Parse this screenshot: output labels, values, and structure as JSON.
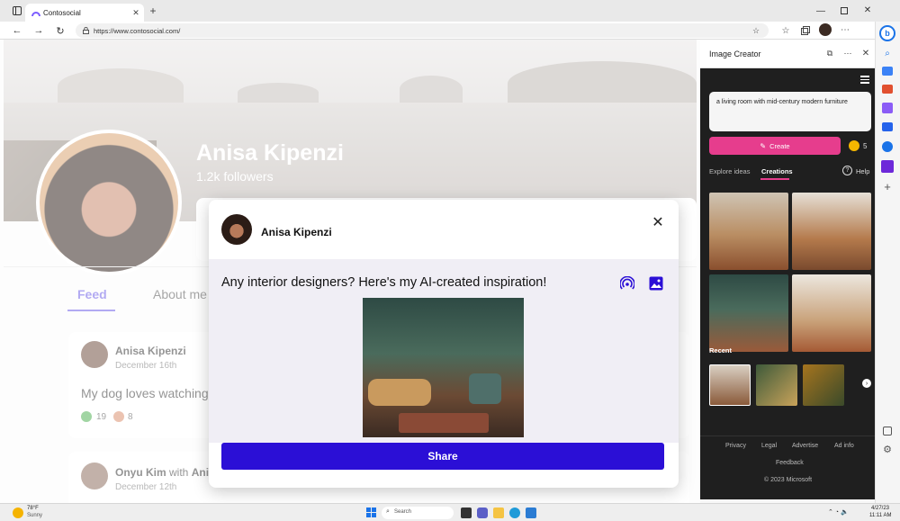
{
  "browser": {
    "tab_title": "Contosocial",
    "url": "https://www.contosocial.com/"
  },
  "profile": {
    "name": "Anisa Kipenzi",
    "followers": "1.2k followers",
    "tabs": [
      "Feed",
      "About me"
    ]
  },
  "feed": [
    {
      "author": "Anisa Kipenzi",
      "date": "December 16th",
      "text": "My dog loves watching",
      "reactions": [
        "19",
        "8"
      ]
    },
    {
      "author": "Onyu Kim",
      "with": "with",
      "tagged": "Anisa Kipenzi",
      "date": "December 12th"
    }
  ],
  "modal": {
    "author": "Anisa Kipenzi",
    "post_text": "Any interior designers? Here's my AI-created inspiration!",
    "share_label": "Share"
  },
  "sidebar": {
    "title": "Image Creator",
    "prompt": "a living room with mid-century modern furniture",
    "create_label": "Create",
    "boosts": "5",
    "tabs": [
      "Explore ideas",
      "Creations"
    ],
    "help_label": "Help",
    "recent_label": "Recent",
    "footer_links": [
      "Privacy",
      "Legal",
      "Advertise",
      "Ad info"
    ],
    "feedback": "Feedback",
    "copyright": "© 2023 Microsoft"
  },
  "taskbar": {
    "weather_temp": "78°F",
    "weather_desc": "Sunny",
    "search_placeholder": "Search",
    "date": "4/27/23",
    "time": "11:11 AM"
  },
  "colors": {
    "accent_purple": "#2b0fd6",
    "create_pink": "#e63d8d",
    "sidebar_bg": "#1f1f1f",
    "feed_tab": "#6c5ce7"
  }
}
